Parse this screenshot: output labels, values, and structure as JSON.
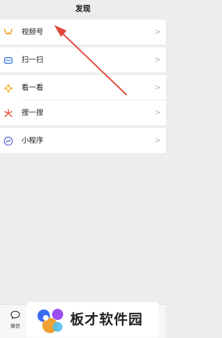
{
  "header": {
    "title": "发现"
  },
  "menu": {
    "groups": [
      {
        "items": [
          {
            "label": "视频号",
            "icon": "channels-icon",
            "chevron": ">"
          }
        ]
      },
      {
        "items": [
          {
            "label": "扫一扫",
            "icon": "scan-icon",
            "chevron": ">"
          }
        ]
      },
      {
        "items": [
          {
            "label": "看一看",
            "icon": "top-stories-icon",
            "chevron": ">"
          },
          {
            "label": "搜一搜",
            "icon": "search-icon",
            "chevron": ">"
          }
        ]
      },
      {
        "items": [
          {
            "label": "小程序",
            "icon": "mini-programs-icon",
            "chevron": ">"
          }
        ]
      }
    ]
  },
  "tabbar": {
    "chats_label": "微信",
    "chats_icon": "chat-bubble-icon"
  },
  "watermark": {
    "text": "板才软件园"
  },
  "colors": {
    "background": "#ededed",
    "annotation_arrow": "#e0473a",
    "chevron": "#b2b2b2"
  }
}
